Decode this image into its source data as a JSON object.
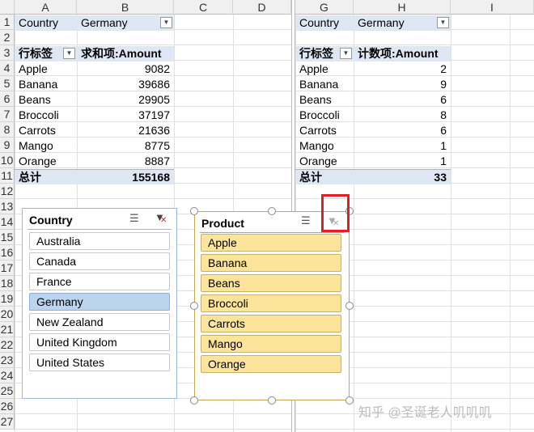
{
  "columns": [
    "A",
    "B",
    "C",
    "D",
    "G",
    "H",
    "I"
  ],
  "rows": [
    "1",
    "2",
    "3",
    "4",
    "5",
    "6",
    "7",
    "8",
    "9",
    "10",
    "11",
    "12",
    "13",
    "14",
    "15",
    "16",
    "17",
    "18",
    "19",
    "20",
    "21",
    "22",
    "23",
    "24",
    "25",
    "26",
    "27"
  ],
  "pivot1": {
    "filter_label": "Country",
    "filter_value": "Germany",
    "row_label": "行标签",
    "value_header": "求和项:Amount",
    "items": [
      {
        "name": "Apple",
        "value": "9082"
      },
      {
        "name": "Banana",
        "value": "39686"
      },
      {
        "name": "Beans",
        "value": "29905"
      },
      {
        "name": "Broccoli",
        "value": "37197"
      },
      {
        "name": "Carrots",
        "value": "21636"
      },
      {
        "name": "Mango",
        "value": "8775"
      },
      {
        "name": "Orange",
        "value": "8887"
      }
    ],
    "total_label": "总计",
    "total_value": "155168"
  },
  "pivot2": {
    "filter_label": "Country",
    "filter_value": "Germany",
    "row_label": "行标签",
    "value_header": "计数项:Amount",
    "items": [
      {
        "name": "Apple",
        "value": "2"
      },
      {
        "name": "Banana",
        "value": "9"
      },
      {
        "name": "Beans",
        "value": "6"
      },
      {
        "name": "Broccoli",
        "value": "8"
      },
      {
        "name": "Carrots",
        "value": "6"
      },
      {
        "name": "Mango",
        "value": "1"
      },
      {
        "name": "Orange",
        "value": "1"
      }
    ],
    "total_label": "总计",
    "total_value": "33"
  },
  "slicer_country": {
    "title": "Country",
    "items": [
      "Australia",
      "Canada",
      "France",
      "Germany",
      "New Zealand",
      "United Kingdom",
      "United States"
    ],
    "selected": "Germany"
  },
  "slicer_product": {
    "title": "Product",
    "items": [
      "Apple",
      "Banana",
      "Beans",
      "Broccoli",
      "Carrots",
      "Mango",
      "Orange"
    ]
  },
  "colors": {
    "selected": "#bcd4ee",
    "product_item": "#fde49b",
    "highlight": "#e02020"
  },
  "watermark": "知乎 @圣诞老人叽叽叽"
}
